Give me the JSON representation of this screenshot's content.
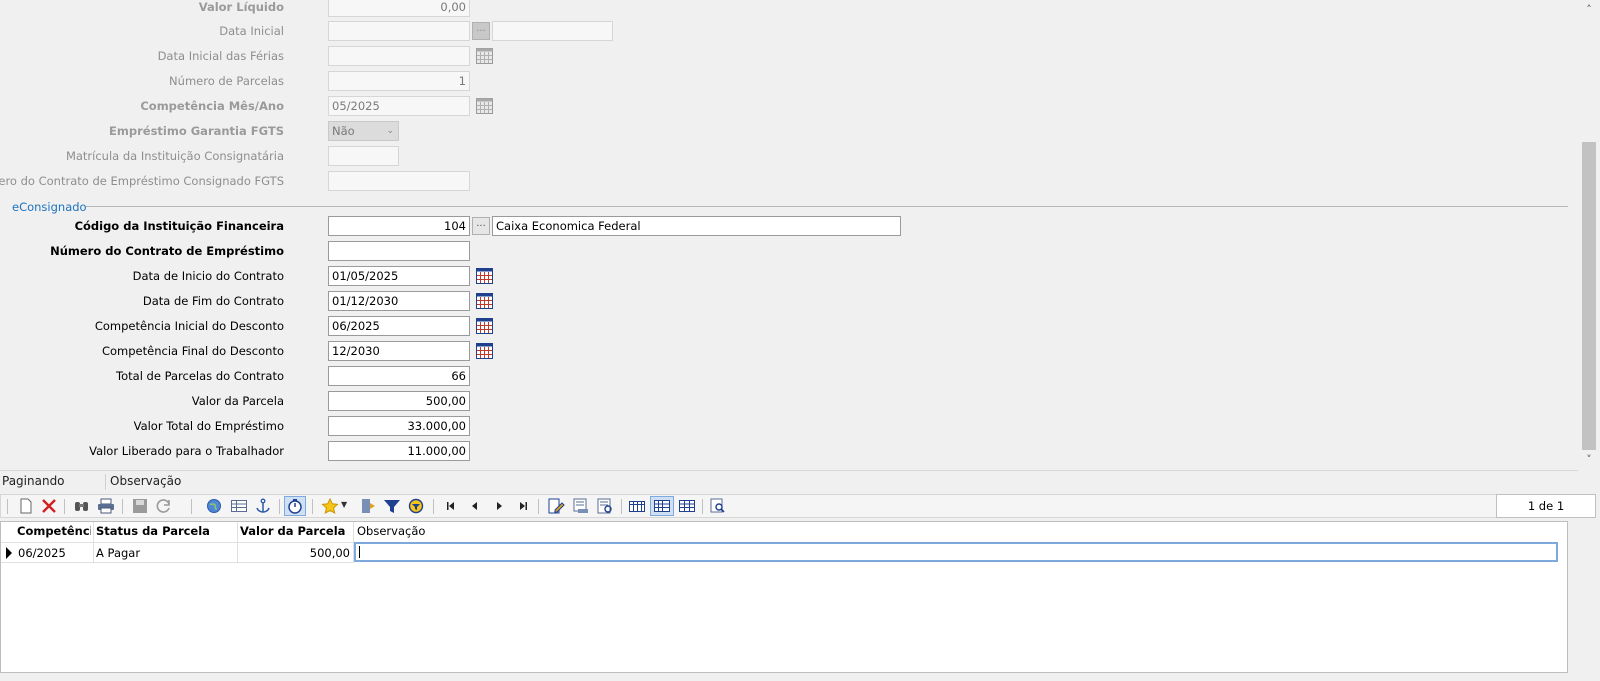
{
  "form": {
    "valor_liquido": {
      "label": "Valor Líquido",
      "value": "0,00"
    },
    "data_inicial": {
      "label": "Data Inicial",
      "value": "",
      "ellipsis": "...",
      "extra_value": ""
    },
    "data_inicial_ferias": {
      "label": "Data Inicial das Férias",
      "value": ""
    },
    "numero_parcelas": {
      "label": "Número de Parcelas",
      "value": "1"
    },
    "competencia_mes_ano": {
      "label": "Competência Mês/Ano",
      "value": "05/2025"
    },
    "emprestimo_garantia_fgts": {
      "label": "Empréstimo Garantia FGTS",
      "value": "Não"
    },
    "matricula_instituicao": {
      "label": "Matrícula da Instituição Consignatária",
      "value": ""
    },
    "numero_contrato_fgts": {
      "label": "Número do Contrato de Empréstimo Consignado FGTS",
      "value": ""
    }
  },
  "econsignado": {
    "section_title": "eConsignado",
    "codigo_instituicao": {
      "label": "Código da Instituição Financeira",
      "value": "104",
      "ellipsis": "...",
      "name": "Caixa Economica Federal"
    },
    "numero_contrato": {
      "label": "Número do Contrato de Empréstimo",
      "value": ""
    },
    "data_inicio_contrato": {
      "label": "Data de Inicio do Contrato",
      "value": "01/05/2025"
    },
    "data_fim_contrato": {
      "label": "Data de Fim do Contrato",
      "value": "01/12/2030"
    },
    "competencia_inicial": {
      "label": "Competência Inicial do Desconto",
      "value": "06/2025"
    },
    "competencia_final": {
      "label": "Competência Final do Desconto",
      "value": "12/2030"
    },
    "total_parcelas": {
      "label": "Total de Parcelas do Contrato",
      "value": "66"
    },
    "valor_parcela": {
      "label": "Valor da Parcela",
      "value": "500,00"
    },
    "valor_total": {
      "label": "Valor Total do Empréstimo",
      "value": "33.000,00"
    },
    "valor_liberado": {
      "label": "Valor Liberado para o Trabalhador",
      "value": "11.000,00"
    }
  },
  "tabs": {
    "paginando": "Paginando",
    "observacao": "Observação"
  },
  "pager": {
    "text": "1 de 1"
  },
  "grid": {
    "columns": [
      "Competência",
      "Status da Parcela",
      "Valor da Parcela",
      "Observação"
    ],
    "rows": [
      {
        "competencia": "06/2025",
        "status": "A Pagar",
        "valor": "500,00",
        "observacao": ""
      }
    ]
  },
  "colors": {
    "accent": "#1e73be",
    "editor_border": "#7ea9dd"
  },
  "icons": [
    "new-icon",
    "delete-icon",
    "find-icon",
    "print-icon",
    "save-icon",
    "refresh-icon",
    "globe-icon",
    "table-icon",
    "anchor-icon",
    "timer-icon",
    "star-icon",
    "exit-icon",
    "filter-icon",
    "clear-filter-icon",
    "first-icon",
    "prev-icon",
    "next-icon",
    "last-icon",
    "edit-icon",
    "view-icon",
    "report-icon",
    "grid-icon",
    "grid-select-icon",
    "grid-config-icon",
    "preview-icon",
    "calendar-icon"
  ]
}
